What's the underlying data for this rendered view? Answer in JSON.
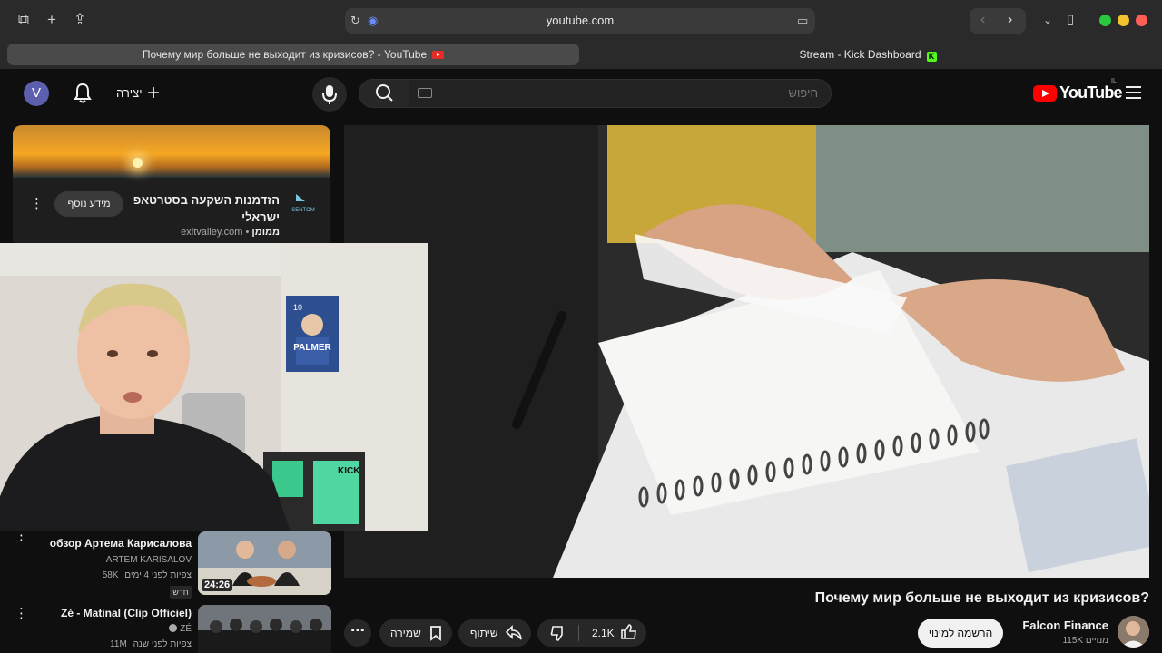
{
  "browser": {
    "url": "youtube.com",
    "tabs": [
      {
        "title": "Почему мир больше не выходит из кризисов? - YouTube",
        "active": true
      },
      {
        "title": "Stream - Kick Dashboard",
        "active": false
      }
    ],
    "traffic_light_colors": [
      "#2ac940",
      "#f4c430",
      "#ff5f57"
    ]
  },
  "header": {
    "avatar_letter": "V",
    "create_label": "יצירה",
    "search_placeholder": "חיפוש",
    "logo_text": "YouTube",
    "logo_country": "IL"
  },
  "ad": {
    "title": "הזדמנות השקעה בסטרטאפ ישראלי",
    "sponsored_label": "ממומן",
    "domain": "exitvalley.com",
    "cta_label": "מידע נוסף",
    "logo_text": "SENTOM"
  },
  "video": {
    "title": "Почему мир больше не выходит из кризисов?",
    "channel_name": "Falcon Finance",
    "subscribers": "115K מנויים",
    "subscribe_label": "הרשמה למינוי",
    "likes": "2.1K",
    "share_label": "שיתוף",
    "save_label": "שמירה"
  },
  "recommendations": [
    {
      "title": "обзор Артема Карисалова",
      "channel": "ARTEM KARISALOV",
      "views": "58K צפיות",
      "age": "לפני 4 ימים",
      "duration": "24:26",
      "badge": "חדש"
    },
    {
      "title": "Zé - Matinal (Clip Officiel)",
      "channel": "ZÉ",
      "views": "11M צפיות",
      "age": "לפני שנה"
    }
  ],
  "webcam": {
    "poster_text": "PALMER",
    "poster_number": "10",
    "sticker_text": "KICK"
  }
}
